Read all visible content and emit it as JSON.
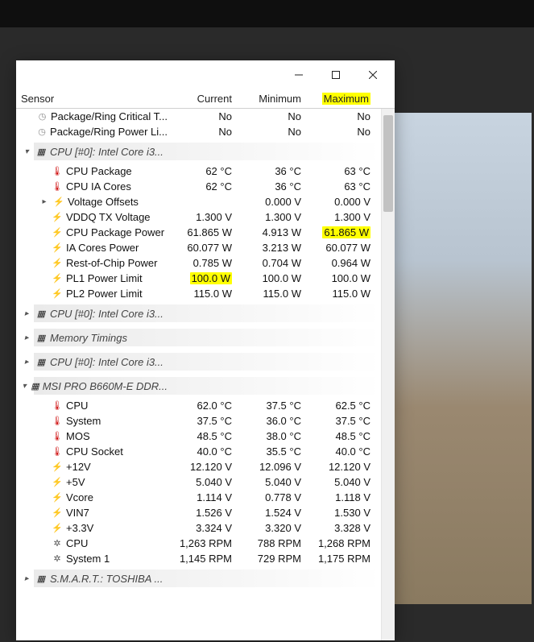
{
  "header": {
    "sensor": "Sensor",
    "current": "Current",
    "minimum": "Minimum",
    "maximum": "Maximum"
  },
  "rows": [
    {
      "icon": "clock",
      "indent": 1,
      "label": "Package/Ring Critical T...",
      "cur": "No",
      "min": "No",
      "max": "No"
    },
    {
      "icon": "clock",
      "indent": 1,
      "label": "Package/Ring Power Li...",
      "cur": "No",
      "min": "No",
      "max": "No"
    }
  ],
  "grp_cpu0": {
    "label": "CPU [#0]: Intel Core i3..."
  },
  "cpu0_rows": [
    {
      "icon": "thermo",
      "label": "CPU Package",
      "cur": "62 °C",
      "min": "36 °C",
      "max": "63 °C"
    },
    {
      "icon": "thermo",
      "label": "CPU IA Cores",
      "cur": "62 °C",
      "min": "36 °C",
      "max": "63 °C"
    },
    {
      "icon": "bolt",
      "label": "Voltage Offsets",
      "cur": "",
      "min": "0.000 V",
      "max": "0.000 V",
      "expand": true
    },
    {
      "icon": "bolt",
      "label": "VDDQ TX Voltage",
      "cur": "1.300 V",
      "min": "1.300 V",
      "max": "1.300 V"
    },
    {
      "icon": "bolt",
      "label": "CPU Package Power",
      "cur": "61.865 W",
      "min": "4.913 W",
      "max": "61.865 W",
      "hl_max": true
    },
    {
      "icon": "bolt",
      "label": "IA Cores Power",
      "cur": "60.077 W",
      "min": "3.213 W",
      "max": "60.077 W"
    },
    {
      "icon": "bolt",
      "label": "Rest-of-Chip Power",
      "cur": "0.785 W",
      "min": "0.704 W",
      "max": "0.964 W"
    },
    {
      "icon": "bolt",
      "label": "PL1 Power Limit",
      "cur": "100.0 W",
      "min": "100.0 W",
      "max": "100.0 W",
      "hl_cur": true
    },
    {
      "icon": "bolt",
      "label": "PL2 Power Limit",
      "cur": "115.0 W",
      "min": "115.0 W",
      "max": "115.0 W"
    }
  ],
  "grp_cpu0b": {
    "label": "CPU [#0]: Intel Core i3..."
  },
  "grp_mem": {
    "label": "Memory Timings"
  },
  "grp_cpu0c": {
    "label": "CPU [#0]: Intel Core i3..."
  },
  "grp_mobo": {
    "label": "MSI PRO B660M-E DDR..."
  },
  "mobo_rows": [
    {
      "icon": "thermo",
      "label": "CPU",
      "cur": "62.0 °C",
      "min": "37.5 °C",
      "max": "62.5 °C"
    },
    {
      "icon": "thermo",
      "label": "System",
      "cur": "37.5 °C",
      "min": "36.0 °C",
      "max": "37.5 °C"
    },
    {
      "icon": "thermo",
      "label": "MOS",
      "cur": "48.5 °C",
      "min": "38.0 °C",
      "max": "48.5 °C"
    },
    {
      "icon": "thermo",
      "label": "CPU Socket",
      "cur": "40.0 °C",
      "min": "35.5 °C",
      "max": "40.0 °C"
    },
    {
      "icon": "bolt",
      "label": "+12V",
      "cur": "12.120 V",
      "min": "12.096 V",
      "max": "12.120 V"
    },
    {
      "icon": "bolt",
      "label": "+5V",
      "cur": "5.040 V",
      "min": "5.040 V",
      "max": "5.040 V"
    },
    {
      "icon": "bolt",
      "label": "Vcore",
      "cur": "1.114 V",
      "min": "0.778 V",
      "max": "1.118 V"
    },
    {
      "icon": "bolt",
      "label": "VIN7",
      "cur": "1.526 V",
      "min": "1.524 V",
      "max": "1.530 V"
    },
    {
      "icon": "bolt",
      "label": "+3.3V",
      "cur": "3.324 V",
      "min": "3.320 V",
      "max": "3.328 V"
    },
    {
      "icon": "fan",
      "label": "CPU",
      "cur": "1,263 RPM",
      "min": "788 RPM",
      "max": "1,268 RPM"
    },
    {
      "icon": "fan",
      "label": "System 1",
      "cur": "1,145 RPM",
      "min": "729 RPM",
      "max": "1,175 RPM"
    }
  ],
  "grp_smart": {
    "label": "S.M.A.R.T.: TOSHIBA ..."
  }
}
